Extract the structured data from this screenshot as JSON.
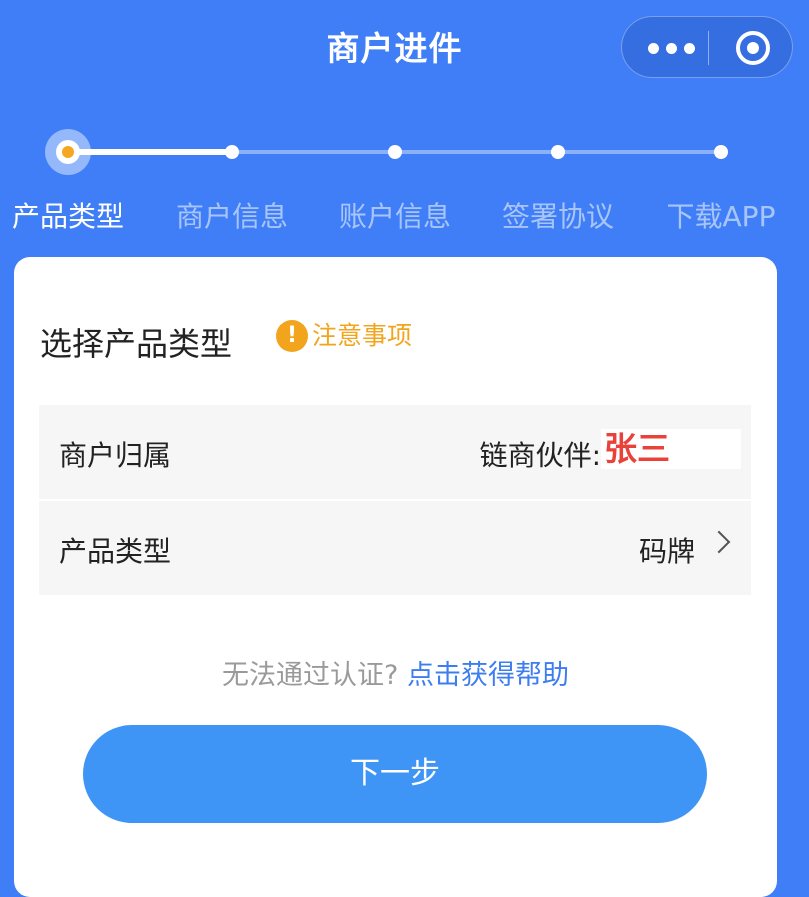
{
  "header": {
    "title": "商户进件",
    "more_icon": "more-dots-icon",
    "close_icon": "target-circle-icon"
  },
  "steps": {
    "current_index": 0,
    "progress_fraction": 0.25,
    "items": [
      {
        "label": "产品类型"
      },
      {
        "label": "商户信息"
      },
      {
        "label": "账户信息"
      },
      {
        "label": "签署协议"
      },
      {
        "label": "下载APP"
      }
    ]
  },
  "card": {
    "title": "选择产品类型",
    "notice": {
      "icon": "exclamation-icon",
      "text": "注意事项"
    },
    "rows": {
      "merchant_owner": {
        "label": "商户归属",
        "value": "链商伙伴:",
        "name": "张三"
      },
      "product_type": {
        "label": "产品类型",
        "value": "码牌"
      }
    },
    "help": {
      "text": "无法通过认证?",
      "link": "点击获得帮助"
    },
    "next_label": "下一步"
  },
  "colors": {
    "background": "#3f7ef6",
    "accent_orange": "#f2a51c",
    "link_blue": "#3d7df2",
    "button_blue": "#3f95f6",
    "name_red": "#e8423a"
  }
}
